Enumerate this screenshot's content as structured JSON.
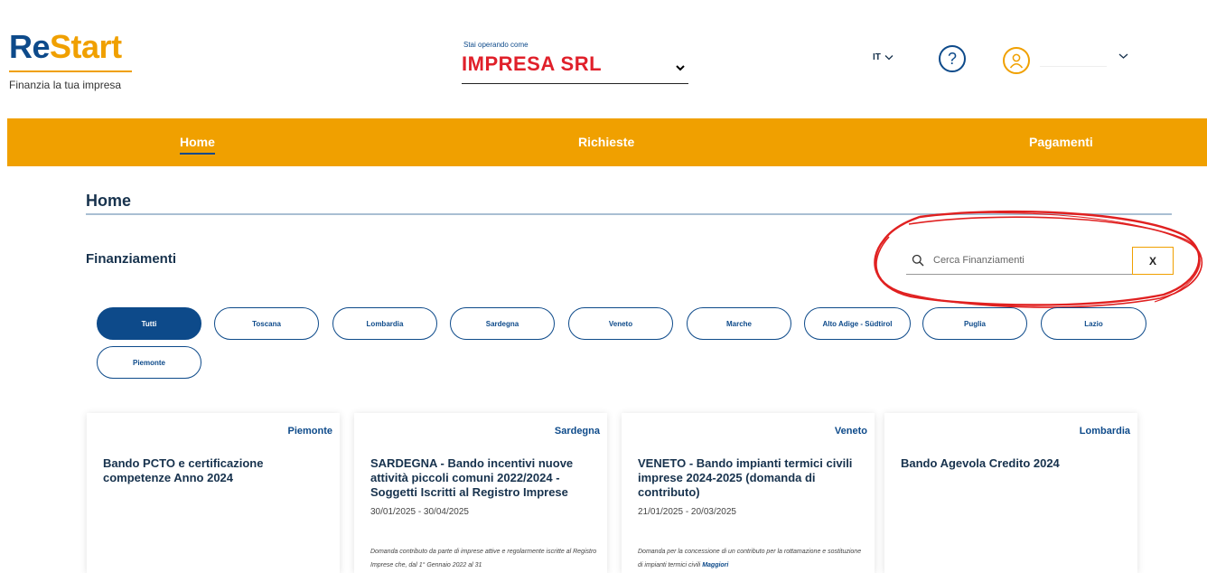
{
  "brand": {
    "re": "Re",
    "start": "Start",
    "tagline": "Finanzia la tua impresa"
  },
  "operator": {
    "label": "Stai operando come",
    "name": "IMPRESA SRL"
  },
  "header": {
    "lang": "IT"
  },
  "nav": [
    {
      "label": "Home",
      "active": true
    },
    {
      "label": "Richieste",
      "active": false
    },
    {
      "label": "Pagamenti",
      "active": false
    }
  ],
  "page": {
    "title": "Home",
    "section": "Finanziamenti"
  },
  "search": {
    "placeholder": "Cerca Finanziamenti",
    "clear_label": "X"
  },
  "filters": [
    "Tutti",
    "Toscana",
    "Lombardia",
    "Sardegna",
    "Veneto",
    "Marche",
    "Alto Adige - Südtirol",
    "Puglia",
    "Lazio",
    "Piemonte"
  ],
  "cards": [
    {
      "region": "Piemonte",
      "title": "Bando PCTO e certificazione competenze Anno 2024",
      "dates": "",
      "description": "",
      "more": ""
    },
    {
      "region": "Sardegna",
      "title": "SARDEGNA - Bando incentivi nuove attività piccoli comuni 2022/2024 - Soggetti Iscritti al Registro Imprese",
      "dates": "30/01/2025 - 30/04/2025",
      "description": "Domanda contributo da parte di imprese attive e regolarmente iscritte al Registro Imprese che, dal 1° Gennaio 2022 al 31",
      "more": ""
    },
    {
      "region": "Veneto",
      "title": "VENETO - Bando impianti termici civili imprese 2024-2025 (domanda di contributo)",
      "dates": "21/01/2025 - 20/03/2025",
      "description": "Domanda per la concessione di un contributo per la rottamazione e sostituzione di impianti termici civili",
      "more": "Maggiori"
    },
    {
      "region": "Lombardia",
      "title": "Bando Agevola Credito 2024",
      "dates": "",
      "description": "",
      "more": ""
    }
  ],
  "colors": {
    "primary": "#0d4a8a",
    "accent": "#f0a000",
    "operator": "#e0202a",
    "annotation": "#e02020"
  }
}
